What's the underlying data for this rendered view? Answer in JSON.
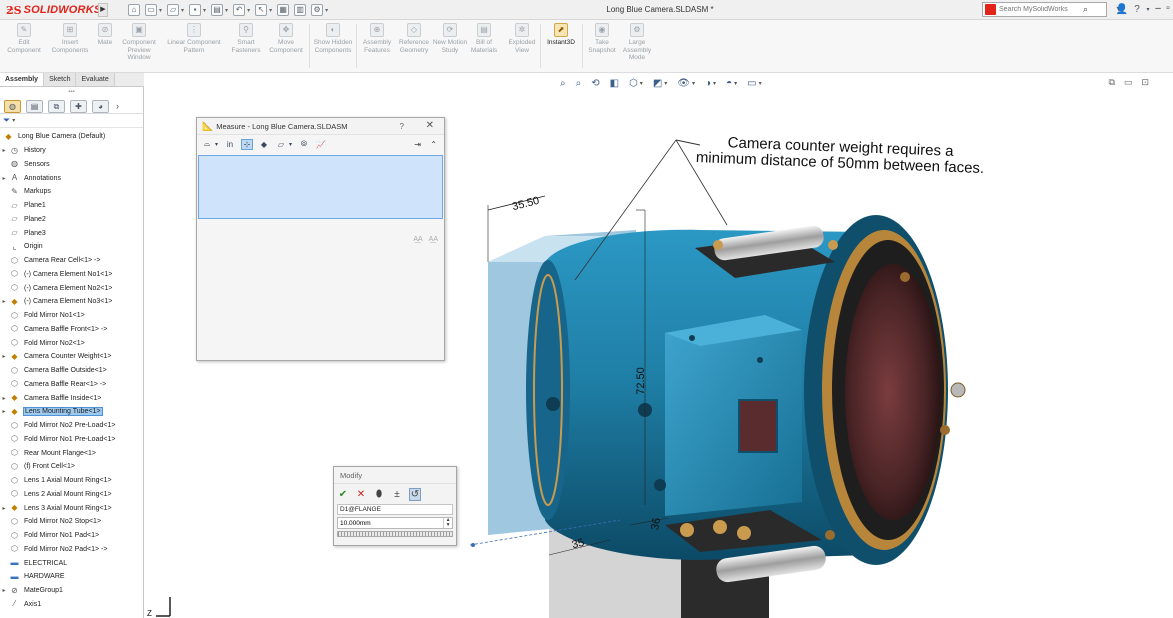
{
  "app": {
    "brand": "SOLIDWORKS",
    "document_title": "Long Blue Camera.SLDASM *"
  },
  "titlebar": {
    "search_placeholder": "Search MySolidWorks",
    "icons": [
      "home-icon",
      "new-icon",
      "open-icon",
      "save-icon",
      "print-icon",
      "undo-icon",
      "select-icon",
      "rebuild-icon",
      "options-icon"
    ],
    "help_label": "?"
  },
  "ribbon": {
    "items": [
      {
        "label": "Edit Component"
      },
      {
        "label": "Insert Components"
      },
      {
        "label": "Mate"
      },
      {
        "label": "Component Preview Window"
      },
      {
        "label": "Linear Component Pattern"
      },
      {
        "label": "Smart Fasteners"
      },
      {
        "label": "Move Component"
      },
      {
        "label": "Show Hidden Components"
      },
      {
        "label": "Assembly Features"
      },
      {
        "label": "Reference Geometry"
      },
      {
        "label": "New Motion Study"
      },
      {
        "label": "Bill of Materials"
      },
      {
        "label": "Exploded View"
      },
      {
        "label": "Instant3D"
      },
      {
        "label": "Take Snapshot"
      },
      {
        "label": "Large Assembly Mode"
      }
    ]
  },
  "command_tabs": [
    "Assembly",
    "Sketch",
    "Evaluate"
  ],
  "tree": {
    "root": "Long Blue Camera  (Default)",
    "items": [
      {
        "label": "History",
        "icon": "history-icon",
        "expand": true
      },
      {
        "label": "Sensors",
        "icon": "sensor-icon",
        "expand": false
      },
      {
        "label": "Annotations",
        "icon": "annotation-icon",
        "expand": true
      },
      {
        "label": "Markups",
        "icon": "markup-icon",
        "expand": false
      },
      {
        "label": "Plane1",
        "icon": "plane-icon",
        "expand": false
      },
      {
        "label": "Plane2",
        "icon": "plane-icon",
        "expand": false
      },
      {
        "label": "Plane3",
        "icon": "plane-icon",
        "expand": false
      },
      {
        "label": "Origin",
        "icon": "origin-icon",
        "expand": false
      },
      {
        "label": "Camera Rear Cell<1> ->",
        "icon": "part-icon",
        "expand": false
      },
      {
        "label": "(-) Camera Element No1<1>",
        "icon": "part-icon",
        "expand": false
      },
      {
        "label": "(-) Camera Element No2<1>",
        "icon": "part-icon",
        "expand": false
      },
      {
        "label": "(-) Camera Element No3<1>",
        "icon": "subassembly-icon",
        "expand": true
      },
      {
        "label": "Fold Mirror No1<1>",
        "icon": "part-icon",
        "expand": false
      },
      {
        "label": "Camera Baffle Front<1> ->",
        "icon": "part-icon",
        "expand": false
      },
      {
        "label": "Fold Mirror No2<1>",
        "icon": "part-icon",
        "expand": false
      },
      {
        "label": "Camera Counter Weight<1>",
        "icon": "subassembly-icon",
        "expand": true
      },
      {
        "label": "Camera Baffle Outside<1>",
        "icon": "part-icon",
        "expand": false
      },
      {
        "label": "Camera Baffle Rear<1> ->",
        "icon": "part-icon",
        "expand": false
      },
      {
        "label": "Camera Baffle Inside<1>",
        "icon": "subassembly-icon",
        "expand": true
      },
      {
        "label": "Lens Mounting Tube<1>",
        "icon": "subassembly-icon",
        "expand": true,
        "selected": true
      },
      {
        "label": "Fold Mirror No2 Pre-Load<1>",
        "icon": "part-icon",
        "expand": false
      },
      {
        "label": "Fold Mirror No1 Pre-Load<1>",
        "icon": "part-icon",
        "expand": false
      },
      {
        "label": "Rear Mount Flange<1>",
        "icon": "part-icon",
        "expand": false
      },
      {
        "label": "(f) Front Cell<1>",
        "icon": "part-icon",
        "expand": false
      },
      {
        "label": "Lens 1 Axial Mount Ring<1>",
        "icon": "part-icon",
        "expand": false
      },
      {
        "label": "Lens 2 Axial Mount Ring<1>",
        "icon": "part-icon",
        "expand": false
      },
      {
        "label": "Lens 3 Axial Mount Ring<1>",
        "icon": "subassembly-icon",
        "expand": true
      },
      {
        "label": "Fold Mirror No2 Stop<1>",
        "icon": "part-icon",
        "expand": false
      },
      {
        "label": "Fold Mirror No1 Pad<1>",
        "icon": "part-icon",
        "expand": false
      },
      {
        "label": "Fold Mirror No2 Pad<1> ->",
        "icon": "part-icon",
        "expand": false
      },
      {
        "label": "ELECTRICAL",
        "icon": "folder-icon",
        "expand": false
      },
      {
        "label": "HARDWARE",
        "icon": "folder-icon",
        "expand": false
      },
      {
        "label": "MateGroup1",
        "icon": "mate-icon",
        "expand": true
      },
      {
        "label": "Axis1",
        "icon": "axis-icon",
        "expand": false
      }
    ]
  },
  "measure_dialog": {
    "title": "Measure - Long Blue Camera.SLDASM",
    "help": "?",
    "unit_button": "in"
  },
  "modify_dialog": {
    "title": "Modify",
    "dimension_name": "D1@FLANGE",
    "dimension_value": "10.000mm"
  },
  "viewport": {
    "annotation_line1": "Camera counter weight requires a",
    "annotation_line2": "minimum distance of 50mm between faces.",
    "dimensions": [
      "35.50",
      "72.50",
      "36",
      "35"
    ],
    "triad_label": "Z",
    "colors": {
      "body": "#1f7fa6",
      "body_dark": "#0f4f6c",
      "flange": "#b8863a",
      "lens": "#5a2e30",
      "selection": "#cfe4fb"
    }
  }
}
